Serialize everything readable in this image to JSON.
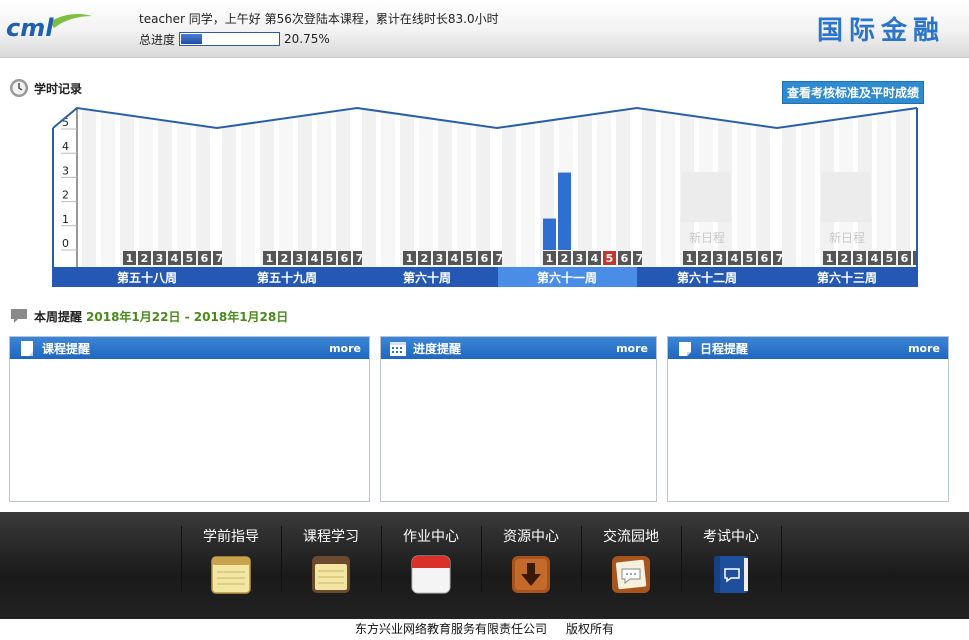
{
  "header": {
    "logo_text": "cml",
    "greeting": "teacher 同学，上午好 第56次登陆本课程，累计在线时长83.0小时",
    "progress_label": "总进度",
    "progress_percent": 20.75,
    "progress_text": "20.75%",
    "brand_title": "国际金融"
  },
  "study_record": {
    "title": "学时记录",
    "standards_button": "查看考核标准及平时成绩",
    "new_schedule_label": "新日程"
  },
  "chart_data": {
    "type": "bar",
    "title": "学时记录",
    "y_ticks": [
      "0",
      "1",
      "2",
      "3",
      "4",
      "5"
    ],
    "ylim": [
      0,
      5
    ],
    "day_labels": [
      "1",
      "2",
      "3",
      "4",
      "5",
      "6",
      "7"
    ],
    "weeks": [
      {
        "name": "第五十八周",
        "values": [
          0,
          0,
          0,
          0,
          0,
          0,
          0
        ],
        "active": false,
        "future": false,
        "today_index": -1
      },
      {
        "name": "第五十九周",
        "values": [
          0,
          0,
          0,
          0,
          0,
          0,
          0
        ],
        "active": false,
        "future": false,
        "today_index": -1
      },
      {
        "name": "第六十周",
        "values": [
          0,
          0,
          0,
          0,
          0,
          0,
          0
        ],
        "active": false,
        "future": false,
        "today_index": -1
      },
      {
        "name": "第六十一周",
        "values": [
          0,
          0,
          1.3,
          3.2,
          0,
          0,
          0
        ],
        "active": true,
        "future": false,
        "today_index": 4
      },
      {
        "name": "第六十二周",
        "values": [
          0,
          0,
          0,
          0,
          0,
          0,
          0
        ],
        "active": false,
        "future": true,
        "today_index": -1
      },
      {
        "name": "第六十三周",
        "values": [
          0,
          0,
          0,
          0,
          0,
          0,
          0
        ],
        "active": false,
        "future": true,
        "today_index": -1
      }
    ],
    "colors": {
      "bar": "#2f6fd0",
      "week_band": "#2458b3",
      "week_active": "#4a8de6",
      "today": "#c0392b",
      "day_box": "#555555"
    }
  },
  "reminders": {
    "title": "本周提醒",
    "date_range": "2018年1月22日 - 2018年1月28日",
    "panels": [
      {
        "title": "课程提醒",
        "more": "more"
      },
      {
        "title": "进度提醒",
        "more": "more"
      },
      {
        "title": "日程提醒",
        "more": "more"
      }
    ]
  },
  "nav": {
    "items": [
      {
        "label": "学前指导",
        "icon": "notepad-icon"
      },
      {
        "label": "课程学习",
        "icon": "notebook-icon"
      },
      {
        "label": "作业中心",
        "icon": "calendar-icon"
      },
      {
        "label": "资源中心",
        "icon": "download-icon"
      },
      {
        "label": "交流园地",
        "icon": "chat-icon"
      },
      {
        "label": "考试中心",
        "icon": "book-icon"
      }
    ]
  },
  "footer": {
    "company": "东方兴业网络教育服务有限责任公司",
    "rights": "版权所有"
  }
}
